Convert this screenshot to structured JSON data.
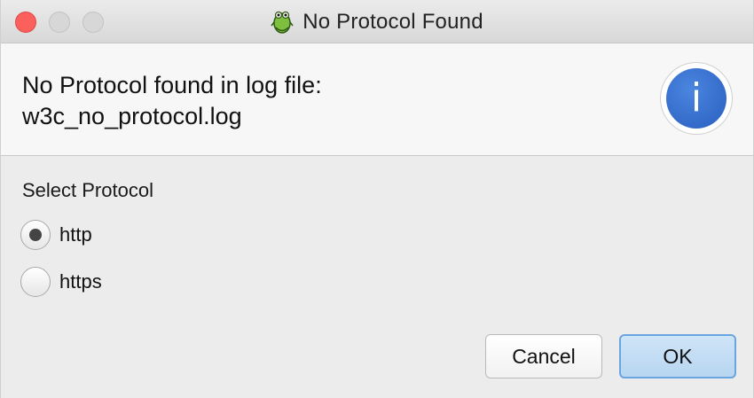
{
  "window": {
    "title": "No Protocol Found",
    "app_icon": "frog-logo-icon"
  },
  "header": {
    "message_line1": "No Protocol found in log file:",
    "message_line2": "w3c_no_protocol.log",
    "icon": "info-icon",
    "icon_glyph": "i",
    "icon_color": "#3a72d3"
  },
  "protocol": {
    "label": "Select Protocol",
    "options": [
      {
        "label": "http",
        "selected": true
      },
      {
        "label": "https",
        "selected": false
      }
    ]
  },
  "buttons": {
    "cancel_label": "Cancel",
    "ok_label": "OK",
    "ok_color": "#b7d6f1"
  },
  "titlebar_controls": {
    "close_color": "#fc605c",
    "inactive_color": "#d7d7d7"
  }
}
